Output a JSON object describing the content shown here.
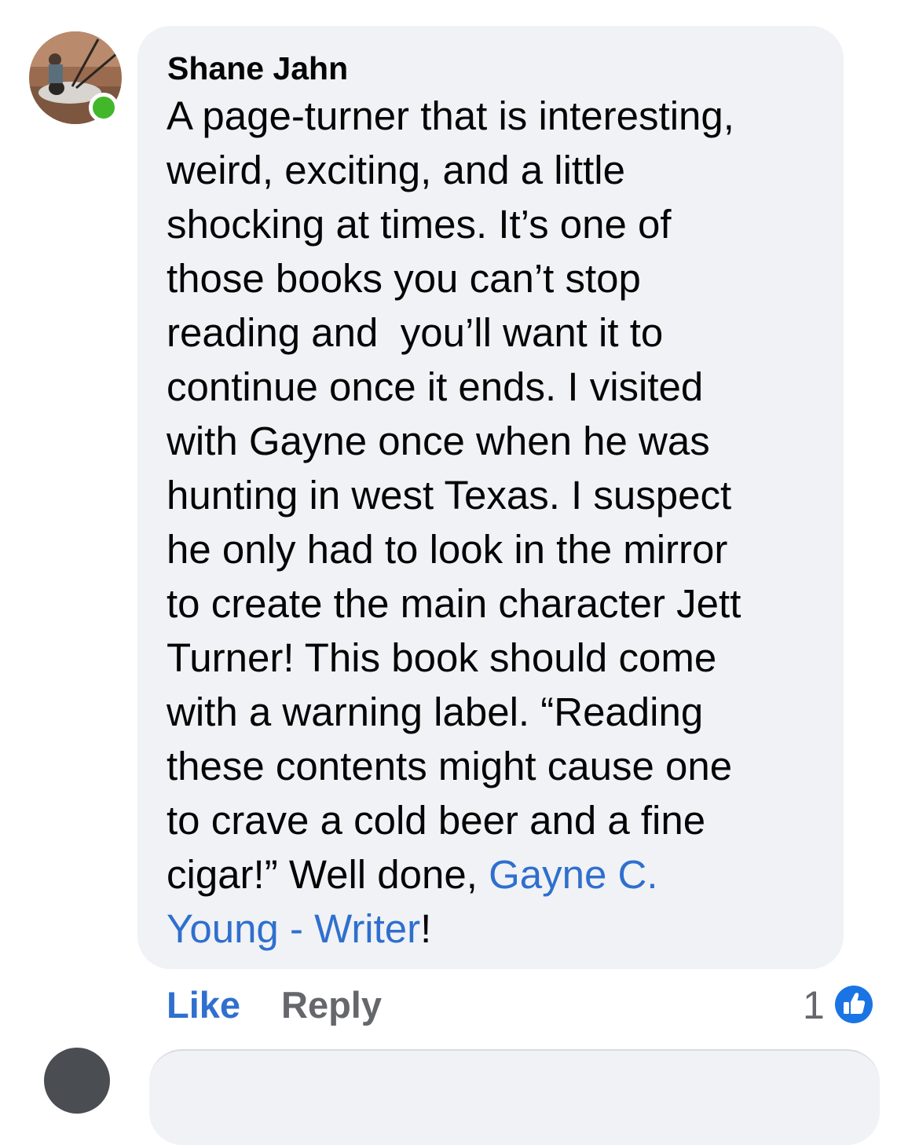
{
  "comment": {
    "author": "Shane Jahn",
    "online": true,
    "status_color": "#42b72a",
    "lines": [
      "A page-turner that is interesting,",
      "weird, exciting, and a little",
      "shocking at times. It’s one of",
      "those books you can’t stop",
      "reading and  you’ll want it to",
      "continue once it ends. I visited",
      "with Gayne once when he was",
      "hunting in west Texas. I suspect",
      "he only had to look in the mirror",
      "to create the main character Jett",
      "Turner! This book should come",
      "with a warning label. “Reading",
      "these contents might cause one",
      "to crave a cold beer and a fine"
    ],
    "line15_before": "cigar!” Well done, ",
    "mention_part1": "Gayne C.",
    "mention_part2": "Young - Writer",
    "line16_after": "!"
  },
  "actions": {
    "like_label": "Like",
    "reply_label": "Reply",
    "reaction_count": "1",
    "reaction_icon": "like-thumb-icon"
  },
  "colors": {
    "link": "#2f6fce",
    "bubble": "#f0f2f5",
    "muted": "#65676b"
  }
}
